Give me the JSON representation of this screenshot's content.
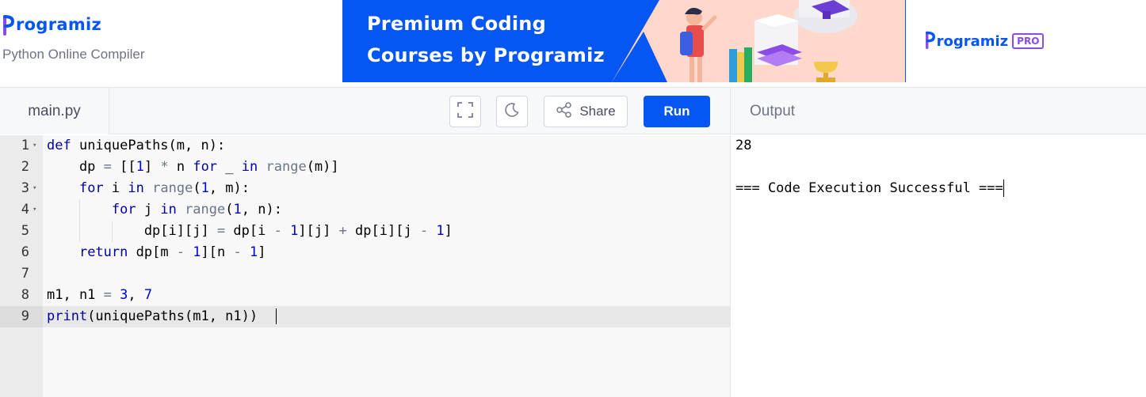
{
  "header": {
    "logo_text": "rogramiz",
    "subtitle": "Python Online Compiler"
  },
  "banner": {
    "line1": "Premium Coding",
    "line2": "Courses by Programiz",
    "pro_name": "rogramiz",
    "pro_badge": "PRO"
  },
  "toolbar": {
    "file_tab": "main.py",
    "share_label": "Share",
    "run_label": "Run",
    "output_label": "Output"
  },
  "editor": {
    "line_numbers": [
      "1",
      "2",
      "3",
      "4",
      "5",
      "6",
      "7",
      "8",
      "9"
    ],
    "lines": [
      [
        {
          "t": "def",
          "c": "k"
        },
        {
          "t": " uniquePaths(m, n):",
          "c": ""
        }
      ],
      [
        {
          "t": "    dp ",
          "c": ""
        },
        {
          "t": "=",
          "c": "o"
        },
        {
          "t": " [[",
          "c": ""
        },
        {
          "t": "1",
          "c": "n"
        },
        {
          "t": "] ",
          "c": ""
        },
        {
          "t": "*",
          "c": "o"
        },
        {
          "t": " n ",
          "c": ""
        },
        {
          "t": "for",
          "c": "k"
        },
        {
          "t": " _ ",
          "c": ""
        },
        {
          "t": "in",
          "c": "k"
        },
        {
          "t": " ",
          "c": ""
        },
        {
          "t": "range",
          "c": "o"
        },
        {
          "t": "(m)]",
          "c": ""
        }
      ],
      [
        {
          "t": "    ",
          "c": ""
        },
        {
          "t": "for",
          "c": "k"
        },
        {
          "t": " i ",
          "c": ""
        },
        {
          "t": "in",
          "c": "k"
        },
        {
          "t": " ",
          "c": ""
        },
        {
          "t": "range",
          "c": "o"
        },
        {
          "t": "(",
          "c": ""
        },
        {
          "t": "1",
          "c": "n"
        },
        {
          "t": ", m):",
          "c": ""
        }
      ],
      [
        {
          "t": "        ",
          "c": ""
        },
        {
          "t": "for",
          "c": "k"
        },
        {
          "t": " j ",
          "c": ""
        },
        {
          "t": "in",
          "c": "k"
        },
        {
          "t": " ",
          "c": ""
        },
        {
          "t": "range",
          "c": "o"
        },
        {
          "t": "(",
          "c": ""
        },
        {
          "t": "1",
          "c": "n"
        },
        {
          "t": ", n):",
          "c": ""
        }
      ],
      [
        {
          "t": "            dp[i][j] ",
          "c": ""
        },
        {
          "t": "=",
          "c": "o"
        },
        {
          "t": " dp[i ",
          "c": ""
        },
        {
          "t": "-",
          "c": "o"
        },
        {
          "t": " ",
          "c": ""
        },
        {
          "t": "1",
          "c": "n"
        },
        {
          "t": "][j] ",
          "c": ""
        },
        {
          "t": "+",
          "c": "o"
        },
        {
          "t": " dp[i][j ",
          "c": ""
        },
        {
          "t": "-",
          "c": "o"
        },
        {
          "t": " ",
          "c": ""
        },
        {
          "t": "1",
          "c": "n"
        },
        {
          "t": "]",
          "c": ""
        }
      ],
      [
        {
          "t": "    ",
          "c": ""
        },
        {
          "t": "return",
          "c": "k"
        },
        {
          "t": " dp[m ",
          "c": ""
        },
        {
          "t": "-",
          "c": "o"
        },
        {
          "t": " ",
          "c": ""
        },
        {
          "t": "1",
          "c": "n"
        },
        {
          "t": "][n ",
          "c": ""
        },
        {
          "t": "-",
          "c": "o"
        },
        {
          "t": " ",
          "c": ""
        },
        {
          "t": "1",
          "c": "n"
        },
        {
          "t": "]",
          "c": ""
        }
      ],
      [],
      [
        {
          "t": "m1, n1 ",
          "c": ""
        },
        {
          "t": "=",
          "c": "o"
        },
        {
          "t": " ",
          "c": ""
        },
        {
          "t": "3",
          "c": "n"
        },
        {
          "t": ", ",
          "c": ""
        },
        {
          "t": "7",
          "c": "n"
        }
      ],
      [
        {
          "t": "print",
          "c": "k"
        },
        {
          "t": "(uniquePaths(m1, n1))",
          "c": ""
        }
      ]
    ],
    "foldable_lines": [
      1,
      3,
      4
    ],
    "active_line": 9
  },
  "output": {
    "lines": [
      "28",
      "",
      "=== Code Execution Successful ==="
    ]
  },
  "colors": {
    "brand_blue": "#0556f3",
    "pro_purple": "#8a4be8",
    "keyword": "#0000a2",
    "number": "#0000cd",
    "operator": "#687687"
  },
  "icons": [
    "fullscreen-icon",
    "moon-icon",
    "share-icon",
    "fold-arrow-icon"
  ]
}
